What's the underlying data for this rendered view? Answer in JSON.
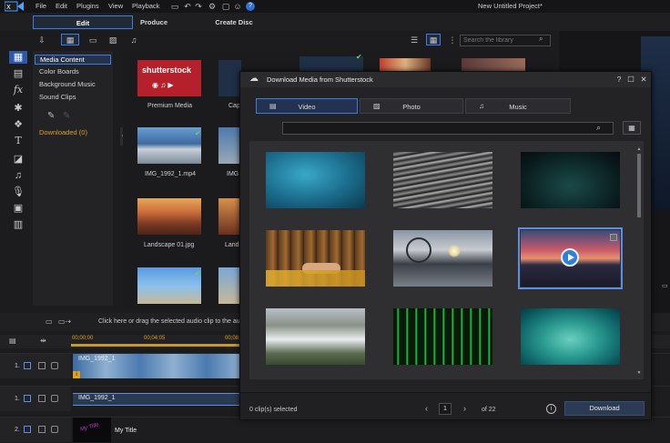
{
  "menu": {
    "items": [
      "File",
      "Edit",
      "Plugins",
      "View",
      "Playback"
    ],
    "project_title": "New Untitled Project*"
  },
  "modes": [
    "Edit",
    "Produce",
    "Create Disc"
  ],
  "library": {
    "search_placeholder": "Search the library",
    "tree": [
      "Media Content",
      "Color Boards",
      "Background Music",
      "Sound Clips"
    ],
    "downloaded": "Downloaded  (0)",
    "captions": [
      "Premium Media",
      "Cap",
      "IMG_1992_1.mp4",
      "IMG",
      "Landscape 01.jpg",
      "Land"
    ],
    "shutterstock_logo": "shutterstock"
  },
  "timeline": {
    "hint": "Click here or drag the selected audio clip to the au",
    "times": [
      "00;00;00",
      "00;04;05",
      "00;08;1"
    ],
    "tracks": [
      {
        "num": "1.",
        "clip": "IMG_1992_1"
      },
      {
        "num": "1.",
        "clip": "IMG_1992_1"
      },
      {
        "num": "2.",
        "clip": "My Title"
      }
    ],
    "title_clip_text": "My Title"
  },
  "dialog": {
    "title": "Download Media from Shutterstock",
    "controls": {
      "help": "?",
      "restore": "☐",
      "close": "✕"
    },
    "tabs": [
      {
        "label": "Video",
        "icon": "film-strip-icon"
      },
      {
        "label": "Photo",
        "icon": "image-icon"
      },
      {
        "label": "Music",
        "icon": "music-note-icon"
      }
    ],
    "search_value": "",
    "selected_count": "0 clip(s) selected",
    "page": "1",
    "page_total": "of 22",
    "download_label": "Download",
    "info": "i"
  }
}
